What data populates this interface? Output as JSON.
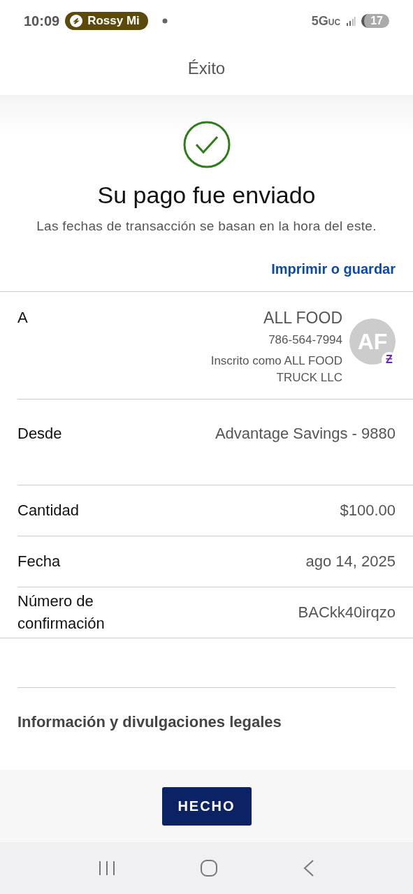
{
  "status_bar": {
    "time": "10:09",
    "media": "Rossy Mi",
    "network": "5G",
    "network_sub": "UC",
    "battery": "17"
  },
  "header": {
    "title": "Éxito"
  },
  "confirmation": {
    "title": "Su pago fue enviado",
    "subtitle": "Las fechas de transacción se basan en la hora del este.",
    "print_link": "Imprimir o guardar"
  },
  "recipient": {
    "label": "A",
    "name": "ALL FOOD",
    "phone": "786-564-7994",
    "enrolled": "Inscrito como ALL FOOD TRUCK LLC",
    "initials": "AF",
    "badge": "Ƶ"
  },
  "details": [
    {
      "label": "Desde",
      "value": "Advantage Savings - 9880"
    },
    {
      "label": "Cantidad",
      "value": "$100.00"
    },
    {
      "label": "Fecha",
      "value": "ago 14, 2025"
    },
    {
      "label": "Número de confirmación",
      "value": "BACkk40irqzo"
    }
  ],
  "legal": {
    "heading": "Información y divulgaciones legales"
  },
  "footer": {
    "button": "HECHO"
  }
}
